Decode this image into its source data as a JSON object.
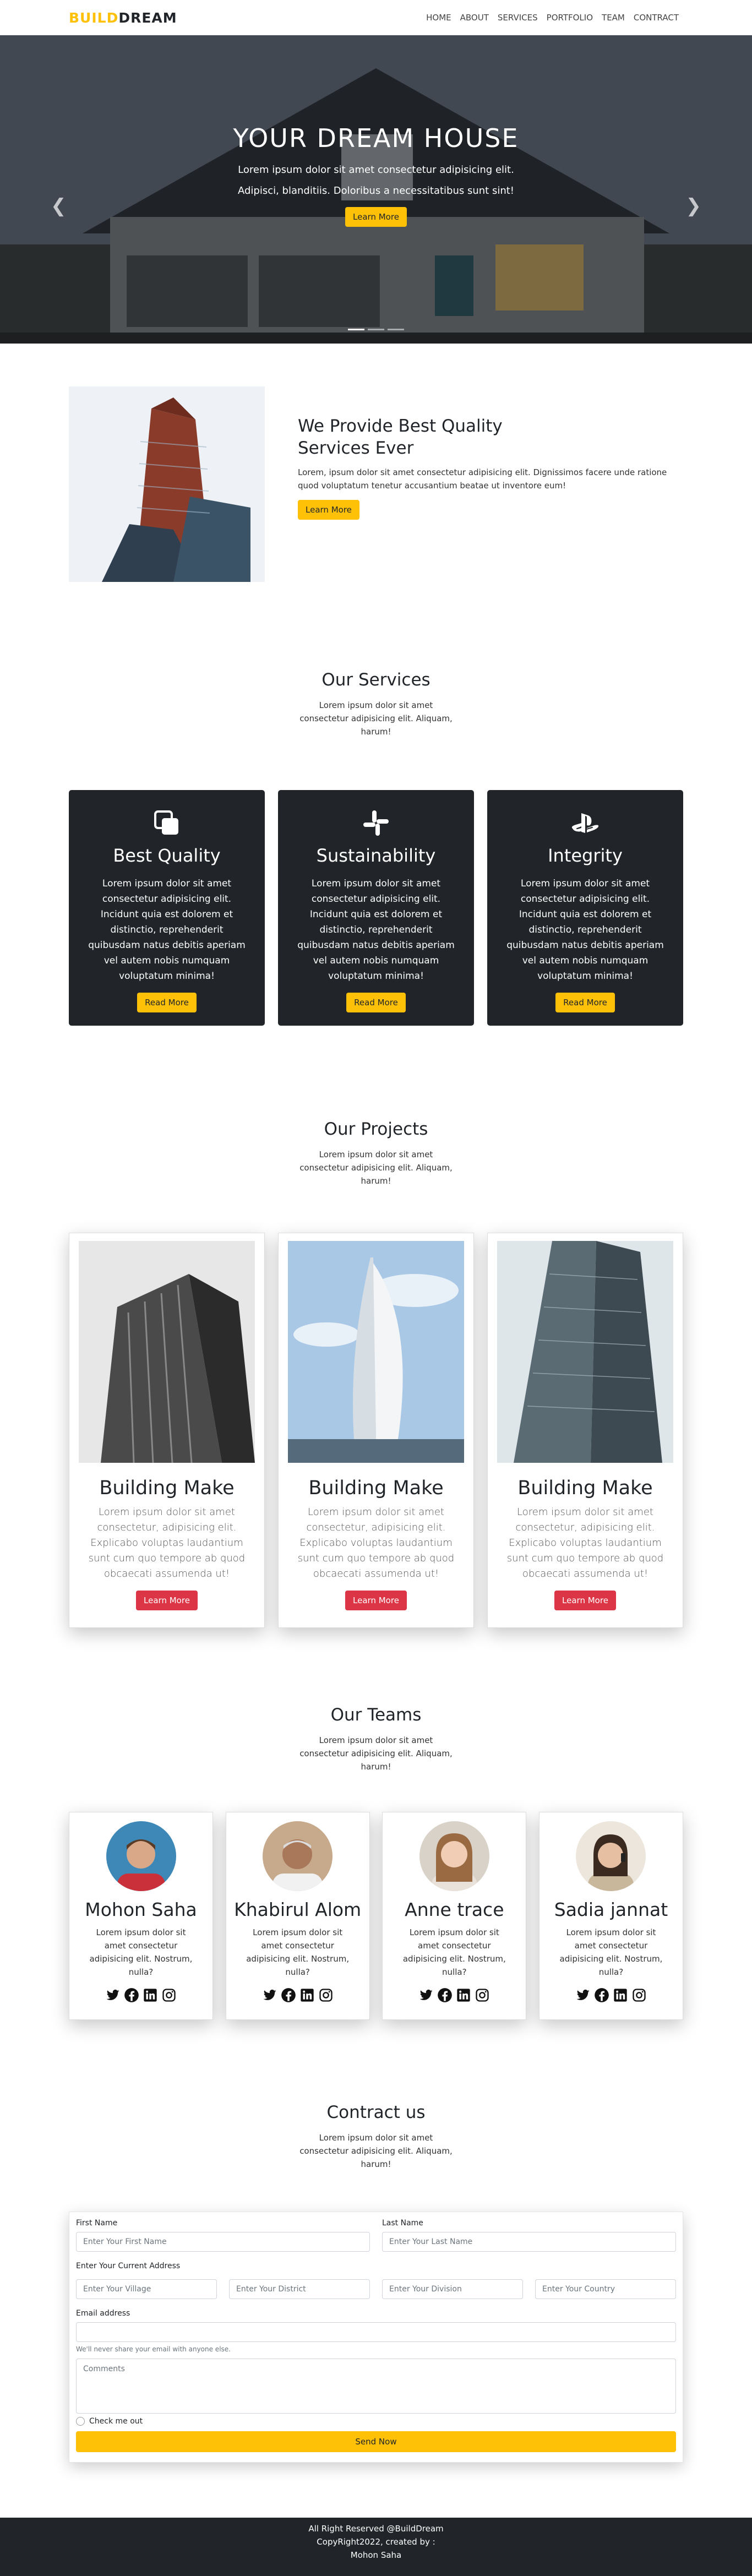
{
  "brand": {
    "part1": "BUILD",
    "part2": "DREAM"
  },
  "nav": [
    "HOME",
    "ABOUT",
    "SERVICES",
    "PORTFOLIO",
    "TEAM",
    "CONTRACT"
  ],
  "hero": {
    "title": "YOUR DREAM HOUSE",
    "text": "Lorem ipsum dolor sit amet consectetur adipisicing elit. Adipisci, blanditiis. Doloribus a necessitatibus sunt sint!",
    "button": "Learn More",
    "prev_icon": "chevron-left-icon",
    "next_icon": "chevron-right-icon",
    "slides": 3,
    "active_slide": 1
  },
  "about": {
    "title": "We Provide Best Quality Services Ever",
    "text": "Lorem, ipsum dolor sit amet consectetur adipisicing elit. Dignissimos facere unde ratione quod voluptatum tenetur accusantium beatae ut inventore eum!",
    "button": "Learn More"
  },
  "services": {
    "title": "Our Services",
    "subtitle": "Lorem ipsum dolor sit amet consectetur adipisicing elit. Aliquam, harum!",
    "cards": [
      {
        "icon": "squares-icon",
        "title": "Best Quality",
        "text": "Lorem ipsum dolor sit amet consectetur adipisicing elit. Incidunt quia est dolorem et distinctio, reprehenderit quibusdam natus debitis aperiam vel autem nobis numquam voluptatum minima!",
        "button": "Read More"
      },
      {
        "icon": "slack-icon",
        "title": "Sustainability",
        "text": "Lorem ipsum dolor sit amet consectetur adipisicing elit. Incidunt quia est dolorem et distinctio, reprehenderit quibusdam natus debitis aperiam vel autem nobis numquam voluptatum minima!",
        "button": "Read More"
      },
      {
        "icon": "playstation-icon",
        "title": "Integrity",
        "text": "Lorem ipsum dolor sit amet consectetur adipisicing elit. Incidunt quia est dolorem et distinctio, reprehenderit quibusdam natus debitis aperiam vel autem nobis numquam voluptatum minima!",
        "button": "Read More"
      }
    ]
  },
  "projects": {
    "title": "Our Projects",
    "subtitle": "Lorem ipsum dolor sit amet consectetur adipisicing elit. Aliquam, harum!",
    "cards": [
      {
        "title": "Building Make",
        "text": "Lorem ipsum dolor sit amet consectetur, adipisicing elit. Explicabo voluptas laudantium sunt cum quo tempore ab quod obcaecati assumenda ut!",
        "button": "Learn More"
      },
      {
        "title": "Building Make",
        "text": "Lorem ipsum dolor sit amet consectetur, adipisicing elit. Explicabo voluptas laudantium sunt cum quo tempore ab quod obcaecati assumenda ut!",
        "button": "Learn More"
      },
      {
        "title": "Building Make",
        "text": "Lorem ipsum dolor sit amet consectetur, adipisicing elit. Explicabo voluptas laudantium sunt cum quo tempore ab quod obcaecati assumenda ut!",
        "button": "Learn More"
      }
    ]
  },
  "teams": {
    "title": "Our Teams",
    "subtitle": "Lorem ipsum dolor sit amet consectetur adipisicing elit. Aliquam, harum!",
    "members": [
      {
        "name": "Mohon Saha",
        "text": "Lorem ipsum dolor sit amet consectetur adipisicing elit. Nostrum, nulla?"
      },
      {
        "name": "Khabirul Alom",
        "text": "Lorem ipsum dolor sit amet consectetur adipisicing elit. Nostrum, nulla?"
      },
      {
        "name": "Anne trace",
        "text": "Lorem ipsum dolor sit amet consectetur adipisicing elit. Nostrum, nulla?"
      },
      {
        "name": "Sadia jannat",
        "text": "Lorem ipsum dolor sit amet consectetur adipisicing elit. Nostrum, nulla?"
      }
    ],
    "social_icons": [
      "twitter-icon",
      "facebook-icon",
      "linkedin-icon",
      "instagram-icon"
    ]
  },
  "contact": {
    "title": "Contract us",
    "subtitle": "Lorem ipsum dolor sit amet consectetur adipisicing elit. Aliquam, harum!",
    "first_name_label": "First Name",
    "first_name_placeholder": "Enter Your First Name",
    "last_name_label": "Last Name",
    "last_name_placeholder": "Enter Your Last Name",
    "address_label": "Enter Your Current Address",
    "village_placeholder": "Enter Your Village",
    "district_placeholder": "Enter Your District",
    "division_placeholder": "Enter Your Division",
    "country_placeholder": "Enter Your Country",
    "email_label": "Email address",
    "email_placeholder": "",
    "email_help": "We'll never share your email with anyone else.",
    "comments_placeholder": "Comments",
    "check_label": "Check me out",
    "submit": "Send Now"
  },
  "footer": {
    "line1": "All Right Reserved @BuildDream",
    "line2": "CopyRight2022, created by :",
    "line3": "Mohon Saha"
  }
}
